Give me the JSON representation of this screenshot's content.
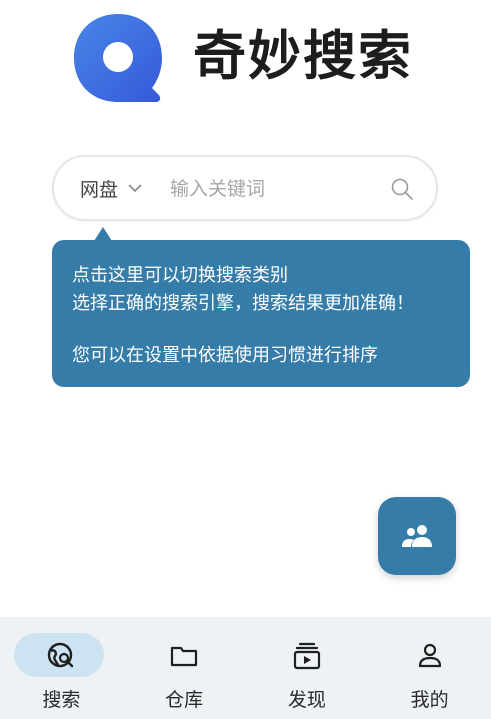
{
  "app": {
    "title": "奇妙搜索"
  },
  "search": {
    "category": "网盘",
    "placeholder": "输入关键词",
    "value": ""
  },
  "tooltip": {
    "line1": "点击这里可以切换搜索类别",
    "line2": "选择正确的搜索引擎，搜索结果更加准确！",
    "line3": "您可以在设置中依据使用习惯进行排序"
  },
  "fab": {
    "icon": "people-icon"
  },
  "nav": {
    "active": "search",
    "items": [
      {
        "label": "搜索",
        "icon": "search-globe-icon"
      },
      {
        "label": "仓库",
        "icon": "folder-icon"
      },
      {
        "label": "发现",
        "icon": "video-collection-icon"
      },
      {
        "label": "我的",
        "icon": "person-icon"
      }
    ]
  },
  "colors": {
    "accent": "#357ca8",
    "nav_background": "#eef2f5",
    "nav_active_pill": "#cde3f2",
    "logo_blue": "#3f6fe0"
  }
}
